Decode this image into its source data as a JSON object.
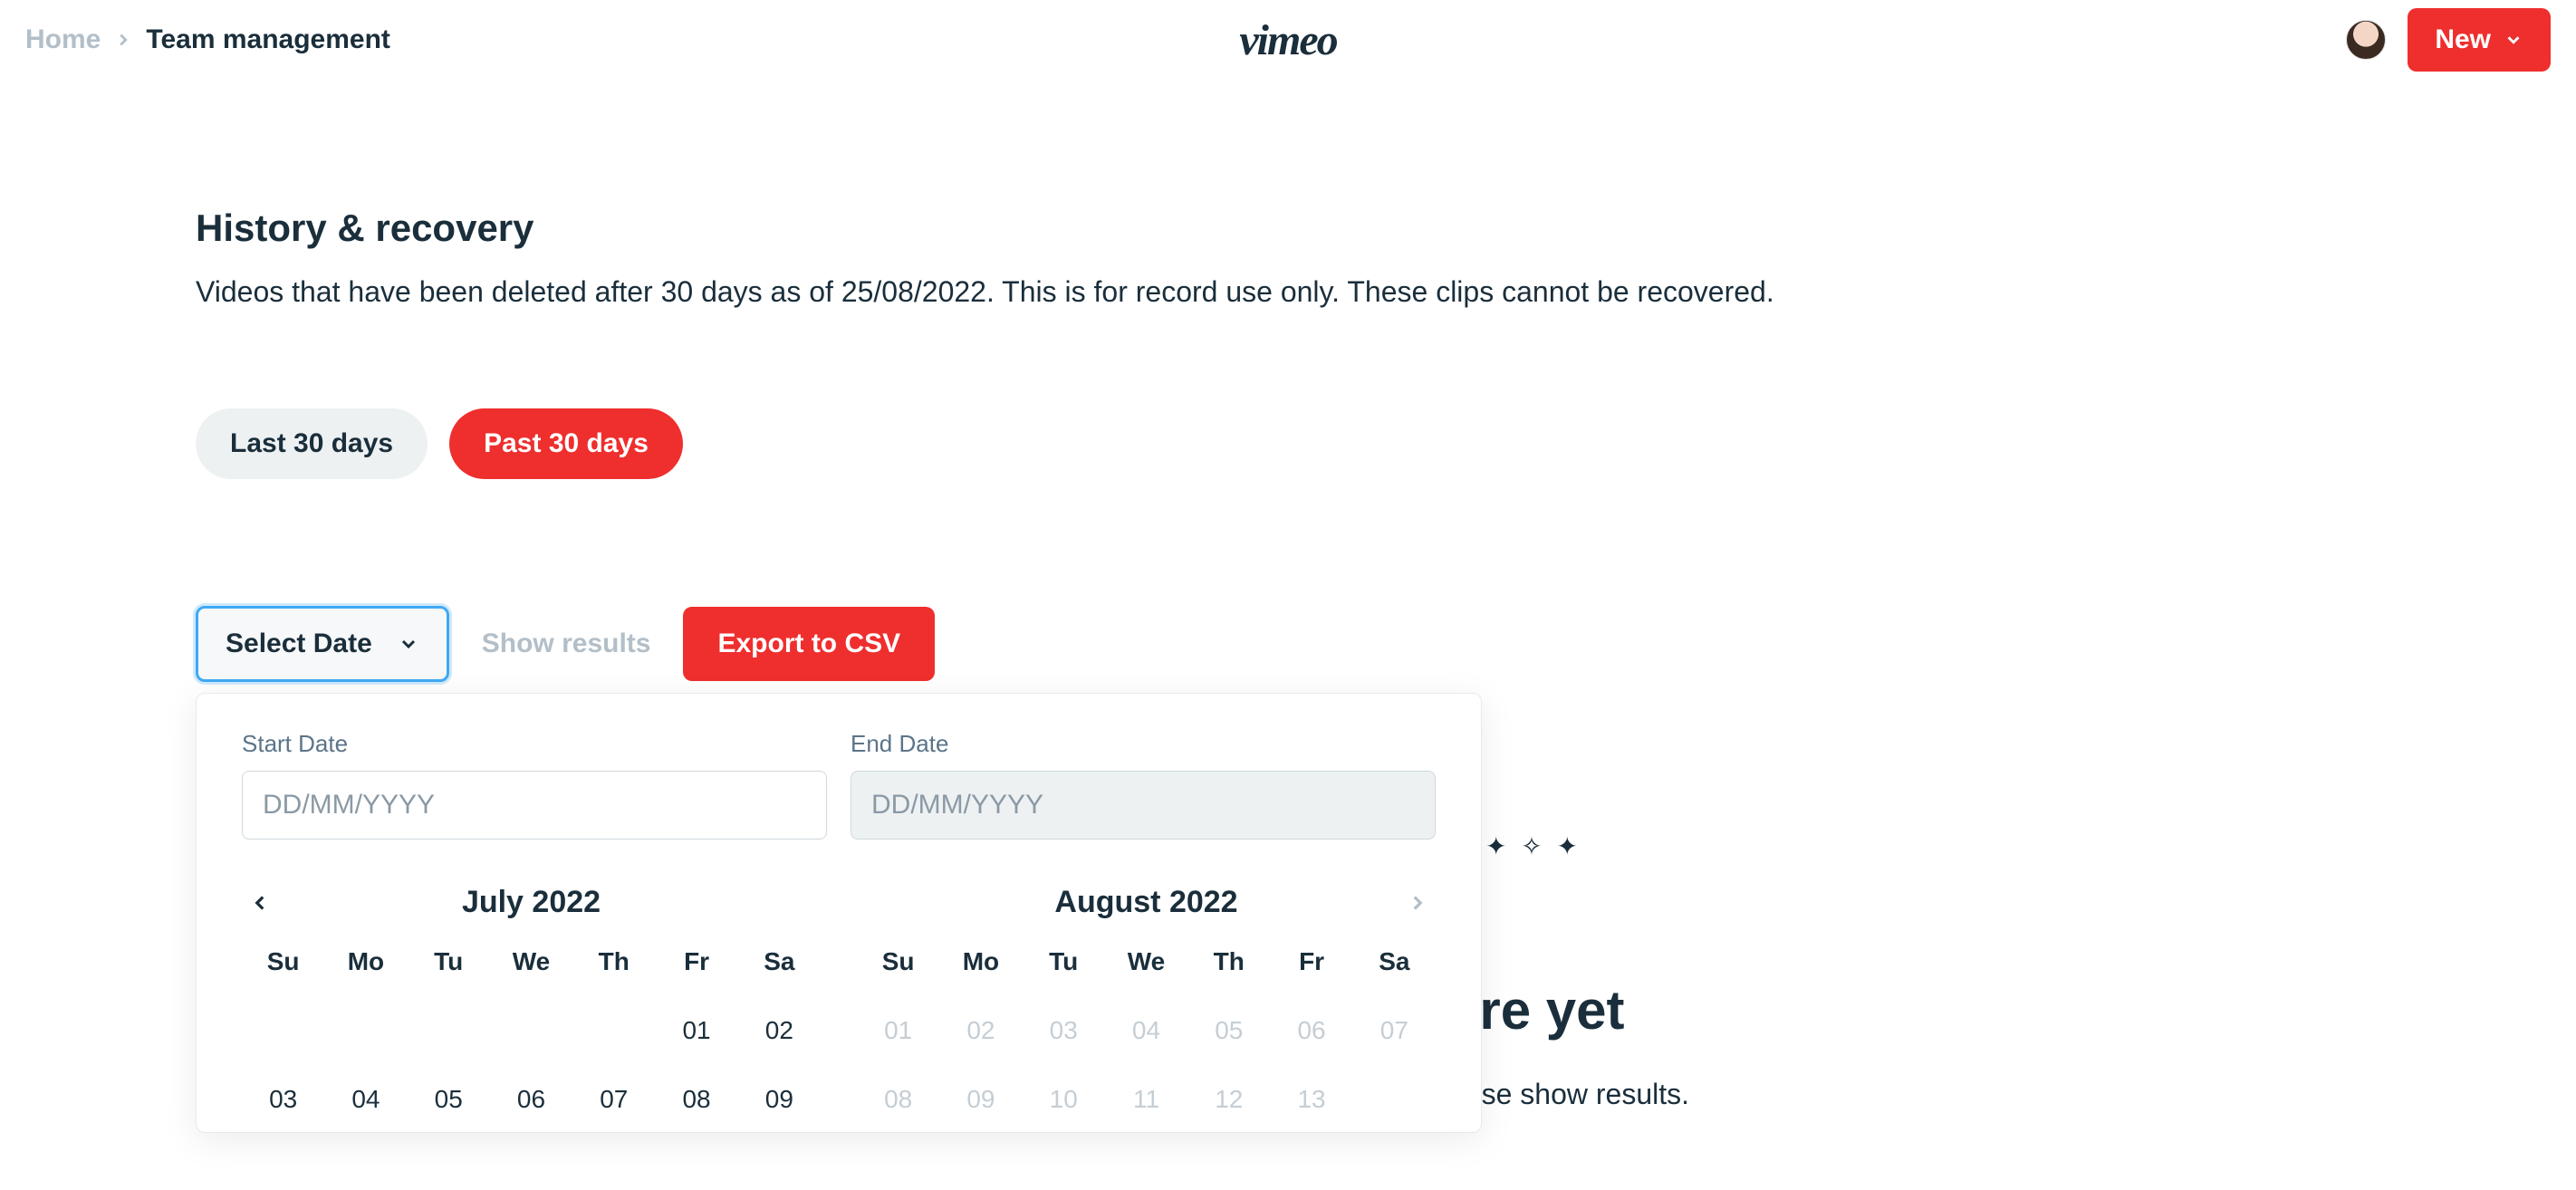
{
  "header": {
    "breadcrumb": {
      "home": "Home",
      "current": "Team management"
    },
    "logo_text": "vimeo",
    "new_button": "New"
  },
  "page": {
    "title": "History & recovery",
    "description": "Videos that have been deleted after 30 days as of 25/08/2022. This is for record use only. These clips cannot be recovered."
  },
  "chips": {
    "last30": "Last 30 days",
    "past30": "Past 30 days"
  },
  "actions": {
    "select_date": "Select Date",
    "show_results": "Show results",
    "export_csv": "Export to CSV"
  },
  "datepicker": {
    "start_label": "Start Date",
    "end_label": "End Date",
    "placeholder": "DD/MM/YYYY",
    "left": {
      "title": "July 2022",
      "dow": [
        "Su",
        "Mo",
        "Tu",
        "We",
        "Th",
        "Fr",
        "Sa"
      ],
      "lead_blanks": 5,
      "days": [
        "01",
        "02",
        "03",
        "04",
        "05",
        "06",
        "07",
        "08",
        "09"
      ],
      "disabled": []
    },
    "right": {
      "title": "August 2022",
      "dow": [
        "Su",
        "Mo",
        "Tu",
        "We",
        "Th",
        "Fr",
        "Sa"
      ],
      "lead_blanks": 0,
      "days": [
        "01",
        "02",
        "03",
        "04",
        "05",
        "06",
        "07",
        "08",
        "09",
        "10",
        "11",
        "12",
        "13"
      ],
      "disabled": [
        "01",
        "02",
        "03",
        "04",
        "05",
        "06",
        "07",
        "08",
        "09",
        "10",
        "11",
        "12",
        "13"
      ]
    }
  },
  "empty_state": {
    "title_fragment": "ere yet",
    "desc_fragment": "oose show results."
  }
}
